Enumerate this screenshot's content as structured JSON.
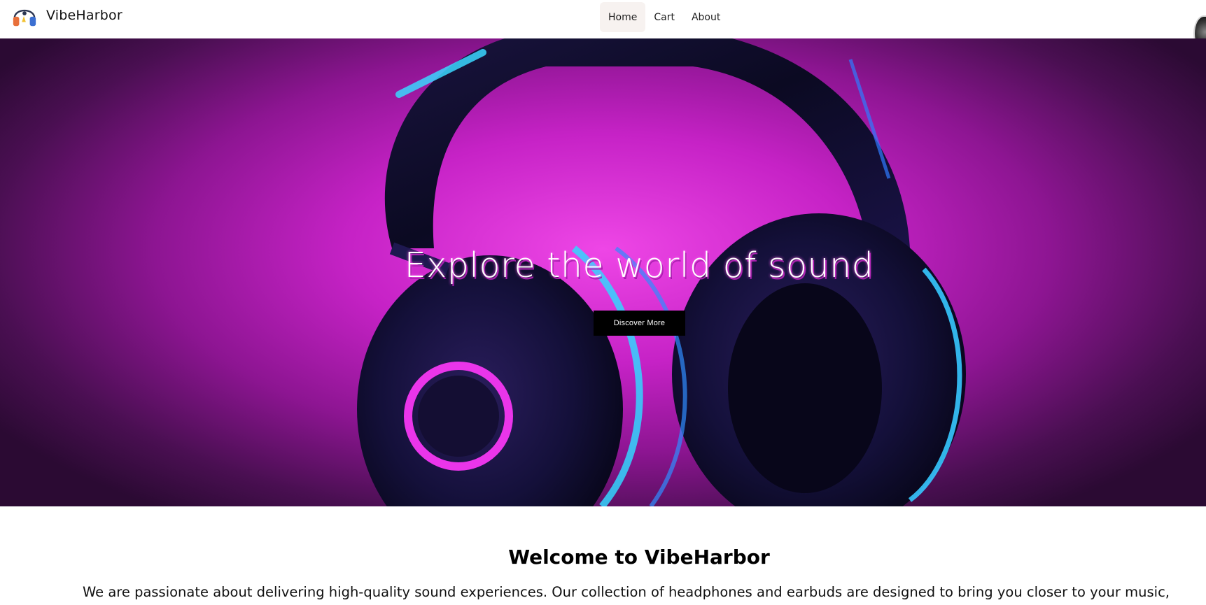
{
  "header": {
    "brand_name": "VibeHarbor",
    "nav": [
      {
        "label": "Home",
        "active": true
      },
      {
        "label": "Cart",
        "active": false
      },
      {
        "label": "About",
        "active": false
      }
    ]
  },
  "hero": {
    "title": "Explore the world of sound",
    "button_label": "Discover More",
    "accent_color": "#d629d6"
  },
  "welcome": {
    "title": "Welcome to VibeHarbor",
    "text": "We are passionate about delivering high-quality sound experiences. Our collection of headphones and earbuds are designed to bring you closer to your music,"
  },
  "icons": {
    "brand_logo": "headphones-logo-icon",
    "corner": "avatar"
  }
}
